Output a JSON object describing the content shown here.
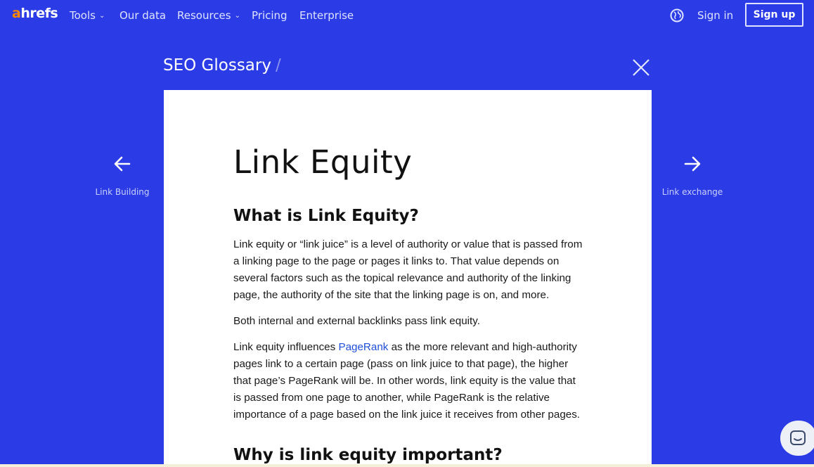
{
  "nav": {
    "logo_a": "a",
    "logo_rest": "hrefs",
    "items": [
      {
        "label": "Tools",
        "dropdown": true
      },
      {
        "label": "Our data",
        "dropdown": false
      },
      {
        "label": "Resources",
        "dropdown": true
      },
      {
        "label": "Pricing",
        "dropdown": false
      },
      {
        "label": "Enterprise",
        "dropdown": false
      }
    ],
    "sign_in": "Sign in",
    "sign_up": "Sign up"
  },
  "glossary": {
    "title": "SEO Glossary",
    "separator": "/",
    "prev_label": "Link Building",
    "next_label": "Link exchange"
  },
  "article": {
    "title": "Link Equity",
    "h2_what": "What is Link Equity?",
    "p1": "Link equity or “link juice” is a level of authority or value that is passed from a linking page to the page or pages it links to. That value depends on several factors such as the topical relevance and authority of the linking page, the authority of the site that the linking page is on, and more.",
    "p2": "Both internal and external backlinks pass link equity.",
    "p3_before": "Link equity influences ",
    "p3_link": "PageRank",
    "p3_after": " as the more relevant and high-authority pages link to a certain page (pass on link juice to that page), the higher that page’s PageRank will be. In other words, link equity is the value that is passed from one page to another, while PageRank is the relative importance of a page based on the link juice it receives from other pages.",
    "h2_why": "Why is link equity important?"
  },
  "colors": {
    "background": "#2b3ce6",
    "logo_accent": "#ff8800",
    "link": "#1f4fd8"
  },
  "icons": [
    "globe-icon",
    "close-icon",
    "arrow-left-icon",
    "arrow-right-icon",
    "chat-icon",
    "chevron-down-icon"
  ]
}
